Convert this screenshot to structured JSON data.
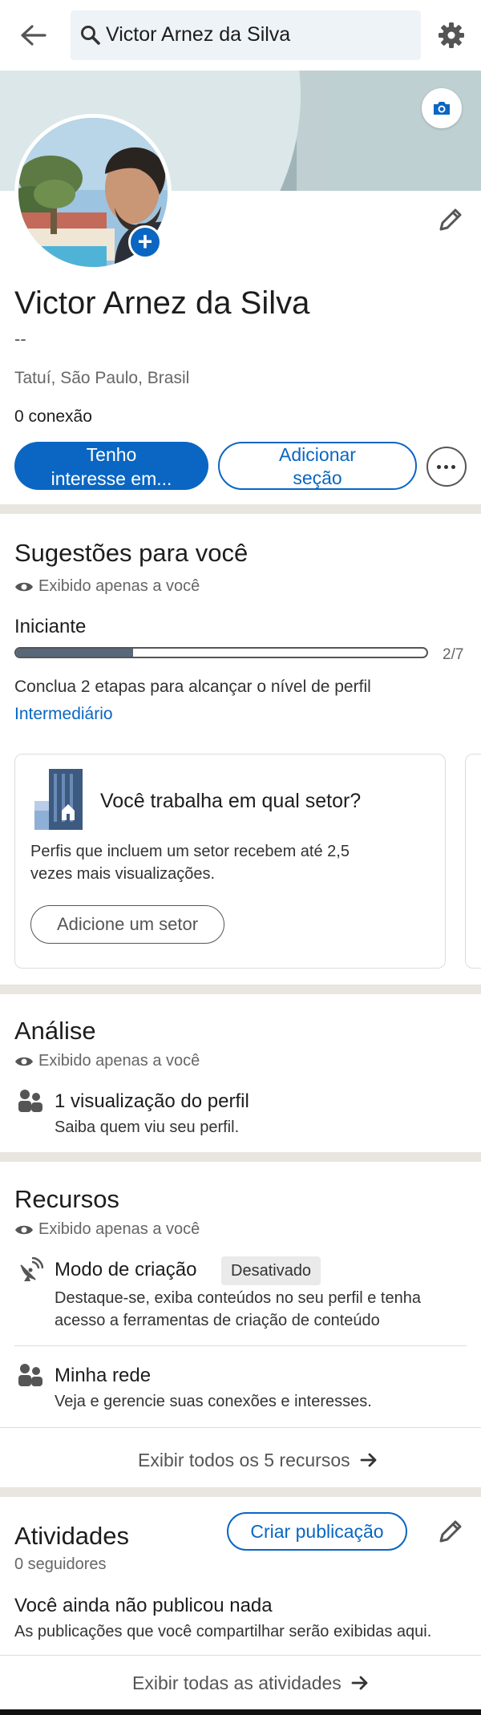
{
  "search": {
    "query": "Victor Arnez da Silva"
  },
  "icons": {
    "back": "arrow-left-icon",
    "search": "search-icon",
    "settings": "gear-icon",
    "camera": "camera-icon",
    "edit": "pencil-icon",
    "add": "plus-icon",
    "more": "more-icon",
    "eye": "eye-icon",
    "people": "people-icon",
    "satellite": "satellite-dish-icon",
    "arrow": "arrow-right-icon"
  },
  "colors": {
    "accent": "#0a66c2",
    "divider": "#e9e5df",
    "progress": "#56687a"
  },
  "profile": {
    "name": "Victor Arnez da Silva",
    "headline": "--",
    "location": "Tatuí, São Paulo, Brasil",
    "connections": "0 conexão",
    "primary_button_line1": "Tenho",
    "primary_button_line2": "interesse em...",
    "secondary_button_line1": "Adicionar",
    "secondary_button_line2": "seção"
  },
  "suggestions": {
    "title": "Sugestões para você",
    "visibility": "Exibido apenas a você",
    "level": "Iniciante",
    "progress_label": "2/7",
    "progress_fraction": 0.286,
    "hint": "Conclua 2 etapas para alcançar o nível de perfil",
    "next_level": "Intermediário",
    "card": {
      "title": "Você trabalha em qual setor?",
      "body_line1": "Perfis que incluem um setor recebem até 2,5",
      "body_line2": "vezes mais visualizações.",
      "button": "Adicione um setor"
    }
  },
  "analytics": {
    "title": "Análise",
    "visibility": "Exibido apenas a você",
    "item_title": "1 visualização do perfil",
    "item_sub": "Saiba quem viu seu perfil."
  },
  "resources": {
    "title": "Recursos",
    "visibility": "Exibido apenas a você",
    "creator_title": "Modo de criação",
    "creator_badge": "Desativado",
    "creator_line1": "Destaque-se, exiba conteúdos no seu perfil e tenha",
    "creator_line2": "acesso a ferramentas de criação de conteúdo",
    "network_title": "Minha rede",
    "network_sub": "Veja e gerencie suas conexões e interesses.",
    "show_all": "Exibir todos os 5 recursos"
  },
  "activity": {
    "title": "Atividades",
    "followers": "0 seguidores",
    "create_post": "Criar publicação",
    "empty_title": "Você ainda não publicou nada",
    "empty_sub": "As publicações que você compartilhar serão exibidas aqui.",
    "show_all": "Exibir todas as atividades"
  }
}
